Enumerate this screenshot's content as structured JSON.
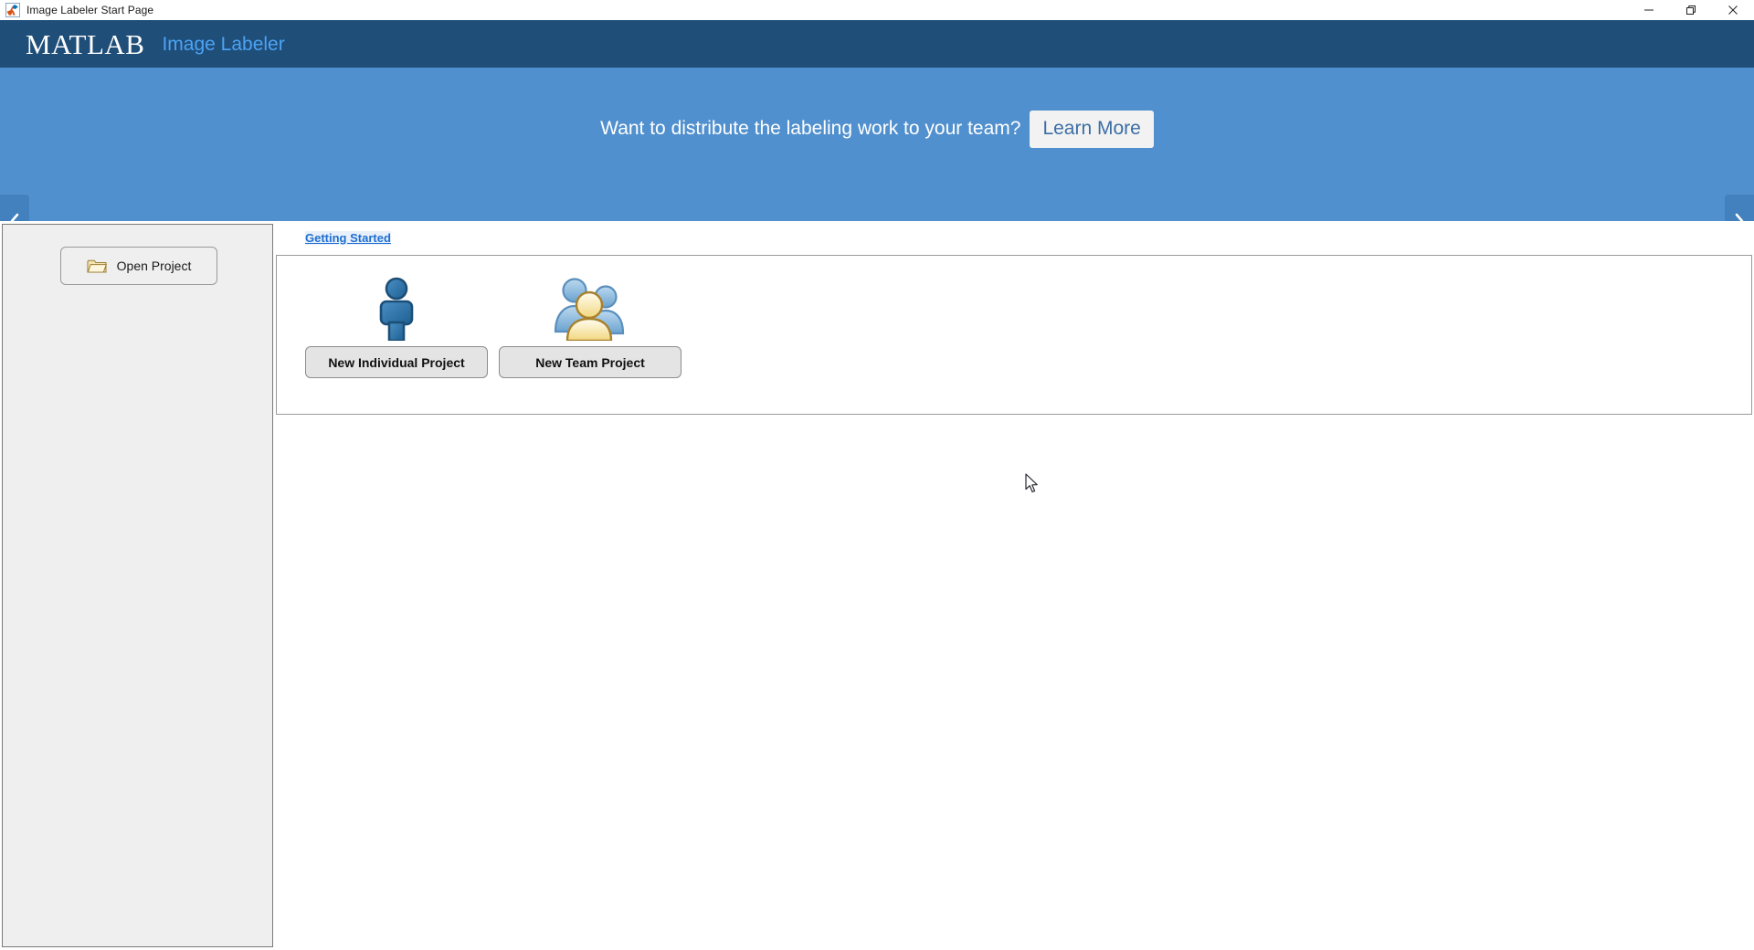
{
  "window": {
    "title": "Image Labeler Start Page",
    "app_icon": "matlab-icon",
    "controls": {
      "minimize": "minimize-icon",
      "restore": "restore-icon",
      "close": "close-icon"
    }
  },
  "header": {
    "brand": "MATLAB",
    "product": "Image Labeler",
    "brand_color": "#ffffff",
    "product_color": "#4da3f5",
    "background_color": "#1f4e79"
  },
  "banner": {
    "message": "Want to distribute the labeling work to your team?",
    "cta_label": "Learn More",
    "background_color": "#5190ce",
    "prev_arrow": "chevron-left-icon",
    "next_arrow": "chevron-right-icon",
    "dots": [
      {
        "state": "active"
      },
      {
        "state": "inactive"
      }
    ]
  },
  "sidebar": {
    "open_project": {
      "label": "Open Project",
      "icon": "folder-icon"
    }
  },
  "main": {
    "getting_started_link": "Getting Started",
    "project_options": [
      {
        "label": "New Individual Project",
        "icon": "single-person-icon"
      },
      {
        "label": "New Team Project",
        "icon": "group-people-icon"
      }
    ]
  },
  "pointer": {
    "icon": "mouse-arrow-cursor"
  }
}
